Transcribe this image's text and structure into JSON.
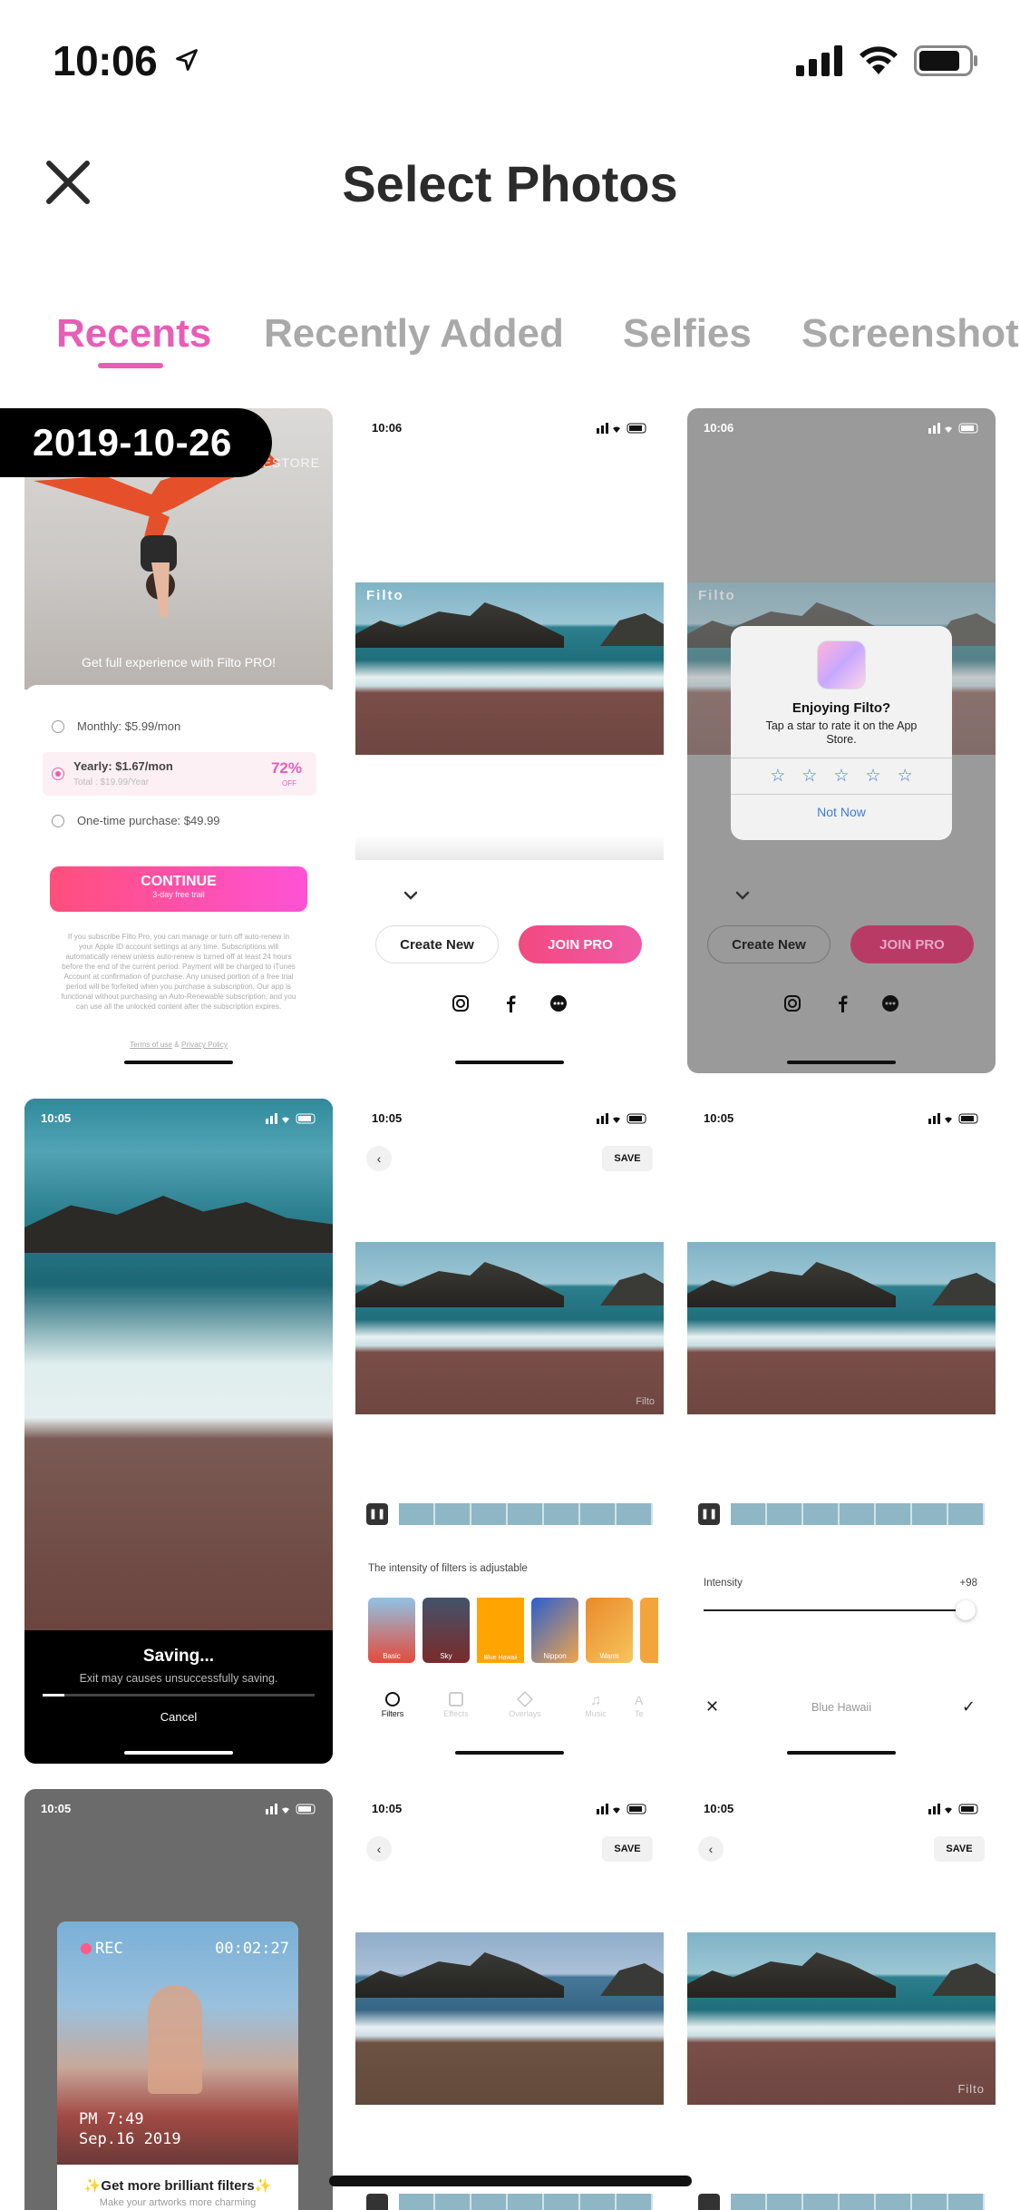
{
  "status_bar": {
    "time": "10:06",
    "location_icon": "location-arrow-icon",
    "signal_icon": "cellular-signal-icon",
    "wifi_icon": "wifi-icon",
    "battery_icon": "battery-icon"
  },
  "header": {
    "close_icon": "close-icon",
    "title": "Select Photos"
  },
  "tabs": [
    {
      "label": "Recents",
      "active": true
    },
    {
      "label": "Recently Added",
      "active": false
    },
    {
      "label": "Selfies",
      "active": false
    },
    {
      "label": "Screenshots",
      "active": false
    }
  ],
  "date_badge": "2019-10-26",
  "colors": {
    "accent": "#e85db6",
    "tab_inactive": "#a9a9a9",
    "join_pro": "#f2497f",
    "continue_gradient_start": "#ff4f7b",
    "continue_gradient_end": "#ff52d6"
  },
  "thumbnails": {
    "t1": {
      "store_text": "RESTORE",
      "promo": "Get full experience with Filto PRO!",
      "options": [
        {
          "label": "Monthly: $5.99/mon",
          "sub": ""
        },
        {
          "label": "Yearly: $1.67/mon",
          "sub": "Total : $19.99/Year",
          "badge": "72%",
          "badge_sub": "OFF"
        },
        {
          "label": "One-time purchase: $49.99",
          "sub": ""
        }
      ],
      "continue": "CONTINUE",
      "continue_sub": "3-day free trail",
      "legal": "If you subscribe Filto Pro, you can manage or turn off auto-renew in your Apple ID account settings at any time. Subscriptions will automatically renew unless auto-renew is turned off at least 24 hours before the end of the current period. Payment will be charged to iTunes Account at confirmation of purchase. Any unused portion of a free trial period will be forfeited when you purchase a subscription. Our app is functional without purchasing an Auto-Renewable subscription, and you can use all the unlocked content after the subscription expires.",
      "terms": "Terms of use",
      "amp": "&",
      "privacy": "Privacy Policy"
    },
    "t2": {
      "time": "10:06",
      "watermark": "Filto",
      "create_new": "Create New",
      "join_pro": "JOIN PRO"
    },
    "t3": {
      "time": "10:06",
      "watermark": "Filto",
      "dialog_title": "Enjoying Filto?",
      "dialog_body": "Tap a star to rate it on the App Store.",
      "not_now": "Not Now",
      "create_new": "Create New",
      "join_pro": "JOIN PRO"
    },
    "t4": {
      "time": "10:05",
      "saving": "Saving...",
      "saving_sub": "Exit may causes unsuccessfully saving.",
      "cancel": "Cancel"
    },
    "t5": {
      "time": "10:05",
      "save": "SAVE",
      "watermark": "Filto",
      "intensity_hint": "The intensity of filters is adjustable",
      "filters": [
        "Basic",
        "Sky",
        "Blue Hawaii",
        "Nippon",
        "Warm"
      ],
      "bottom_tabs": [
        "Filters",
        "Effects",
        "Overlays",
        "Music",
        "Te"
      ]
    },
    "t6": {
      "time": "10:05",
      "intensity_label": "Intensity",
      "intensity_value": "+98",
      "filter_name": "Blue Hawaii"
    },
    "t7": {
      "time": "10:05",
      "rec": "REC",
      "timecode": "00:02:27",
      "pm": "PM 7:49",
      "date": "Sep.16 2019",
      "promo": "✨Get more brilliant filters✨",
      "promo_sub": "Make your artworks more charming"
    },
    "t8": {
      "time": "10:05",
      "save": "SAVE"
    },
    "t9": {
      "time": "10:05",
      "save": "SAVE",
      "watermark": "Filto"
    }
  }
}
